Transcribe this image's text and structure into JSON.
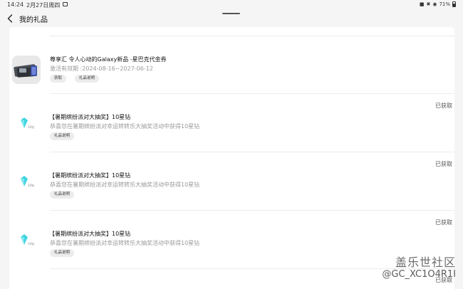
{
  "statusbar": {
    "time": "14:24",
    "date": "2月27日周四",
    "battery": "71%"
  },
  "header": {
    "title": "我的礼品"
  },
  "gifts": [
    {
      "title": "尊享汇 令人心动的Galaxy新品 -星巴克代金券",
      "validity": "激活有效期 :2024-08-16~2027-06-12",
      "get_label": "获取",
      "info_label": "礼品说明",
      "icon": "starbucks-card-icon"
    },
    {
      "title": "【暑期缤纷派对大抽奖】10星钻",
      "desc": "恭喜您在暑期缤纷派对幸运转转乐大抽奖活动中获得10星钻",
      "info_label": "礼品说明",
      "status": "已获取",
      "icon": "diamond-icon"
    },
    {
      "title": "【暑期缤纷派对大抽奖】10星钻",
      "desc": "恭喜您在暑期缤纷派对幸运转转乐大抽奖活动中获得10星钻",
      "info_label": "礼品说明",
      "status": "已获取",
      "icon": "diamond-icon"
    },
    {
      "title": "【暑期缤纷派对大抽奖】10星钻",
      "desc": "恭喜您在暑期缤纷派对幸运转转乐大抽奖活动中获得10星钻",
      "info_label": "礼品说明",
      "status": "已获取",
      "icon": "diamond-icon"
    }
  ],
  "diamond_caption": "10钻",
  "partial_status": "已获取",
  "watermark": {
    "title": "盖乐世社区",
    "handle": "@GC_XC1O4R1I"
  },
  "colors": {
    "background": "#f5f5f5",
    "card": "#ffffff",
    "diamond": "#3fd3e0",
    "muted_text": "#999999"
  }
}
